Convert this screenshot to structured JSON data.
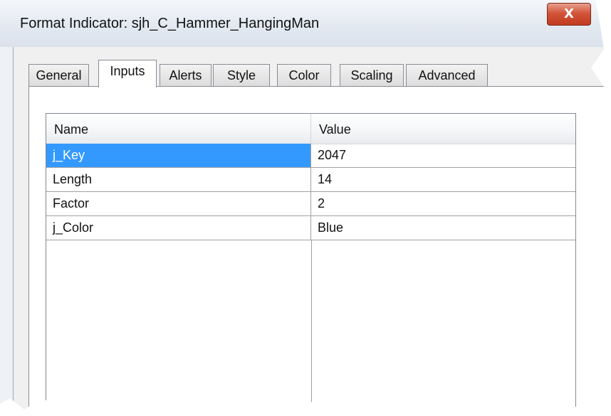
{
  "window": {
    "title": "Format Indicator: sjh_C_Hammer_HangingMan",
    "close_label": "X"
  },
  "tabs": [
    {
      "label": "General",
      "active": false
    },
    {
      "label": "Inputs",
      "active": true
    },
    {
      "label": "Alerts",
      "active": false
    },
    {
      "label": "Style",
      "active": false
    },
    {
      "label": "Color",
      "active": false
    },
    {
      "label": "Scaling",
      "active": false
    },
    {
      "label": "Advanced",
      "active": false
    }
  ],
  "grid": {
    "columns": [
      "Name",
      "Value"
    ],
    "rows": [
      {
        "name": "j_Key",
        "value": "2047",
        "selected": true
      },
      {
        "name": "Length",
        "value": "14",
        "selected": false
      },
      {
        "name": "Factor",
        "value": "2",
        "selected": false
      },
      {
        "name": "j_Color",
        "value": "Blue",
        "selected": false
      }
    ]
  },
  "colors": {
    "selection": "#3399ff",
    "close_button": "#c23a1f"
  }
}
